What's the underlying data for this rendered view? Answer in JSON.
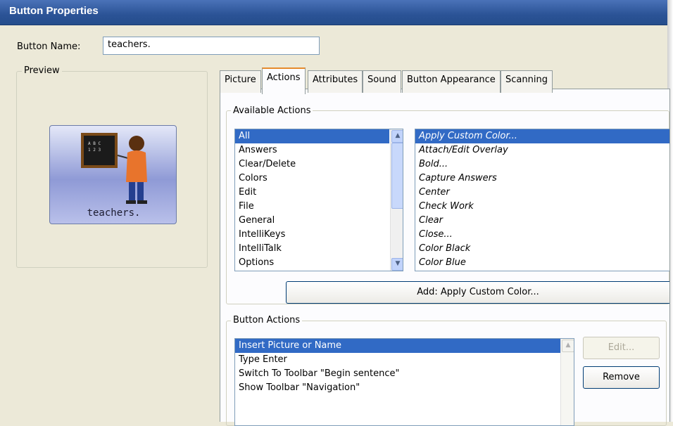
{
  "window": {
    "title": "Button Properties"
  },
  "button_name": {
    "label": "Button Name:",
    "value": "teachers."
  },
  "preview": {
    "caption": "Preview",
    "image_label": "teachers.",
    "chalkboard_text": "A B C\n1 2 3"
  },
  "tabs": [
    {
      "label": "Picture",
      "active": false
    },
    {
      "label": "Actions",
      "active": true
    },
    {
      "label": "Attributes",
      "active": false
    },
    {
      "label": "Sound",
      "active": false
    },
    {
      "label": "Button Appearance",
      "active": false
    },
    {
      "label": "Scanning",
      "active": false
    }
  ],
  "available_actions": {
    "caption": "Available Actions",
    "categories": [
      "All",
      "Answers",
      "Clear/Delete",
      "Colors",
      "Edit",
      "File",
      "General",
      "IntelliKeys",
      "IntelliTalk",
      "Options"
    ],
    "selected_category": "All",
    "actions": [
      "Apply Custom Color...",
      "Attach/Edit Overlay",
      "Bold...",
      "Capture Answers",
      "Center",
      "Check Work",
      "Clear",
      "Close...",
      "Color Black",
      "Color Blue"
    ],
    "selected_action": "Apply Custom Color...",
    "add_button": "Add:  Apply Custom Color..."
  },
  "button_actions": {
    "caption": "Button Actions",
    "items": [
      "Insert Picture or Name",
      "Type Enter",
      "Switch To Toolbar \"Begin sentence\"",
      "Show Toolbar \"Navigation\""
    ],
    "selected": "Insert Picture or Name",
    "edit_button": "Edit...",
    "remove_button": "Remove"
  },
  "colors": {
    "titlebar": "#2b5396",
    "selection": "#316ac5",
    "dialog": "#ece9d8"
  }
}
